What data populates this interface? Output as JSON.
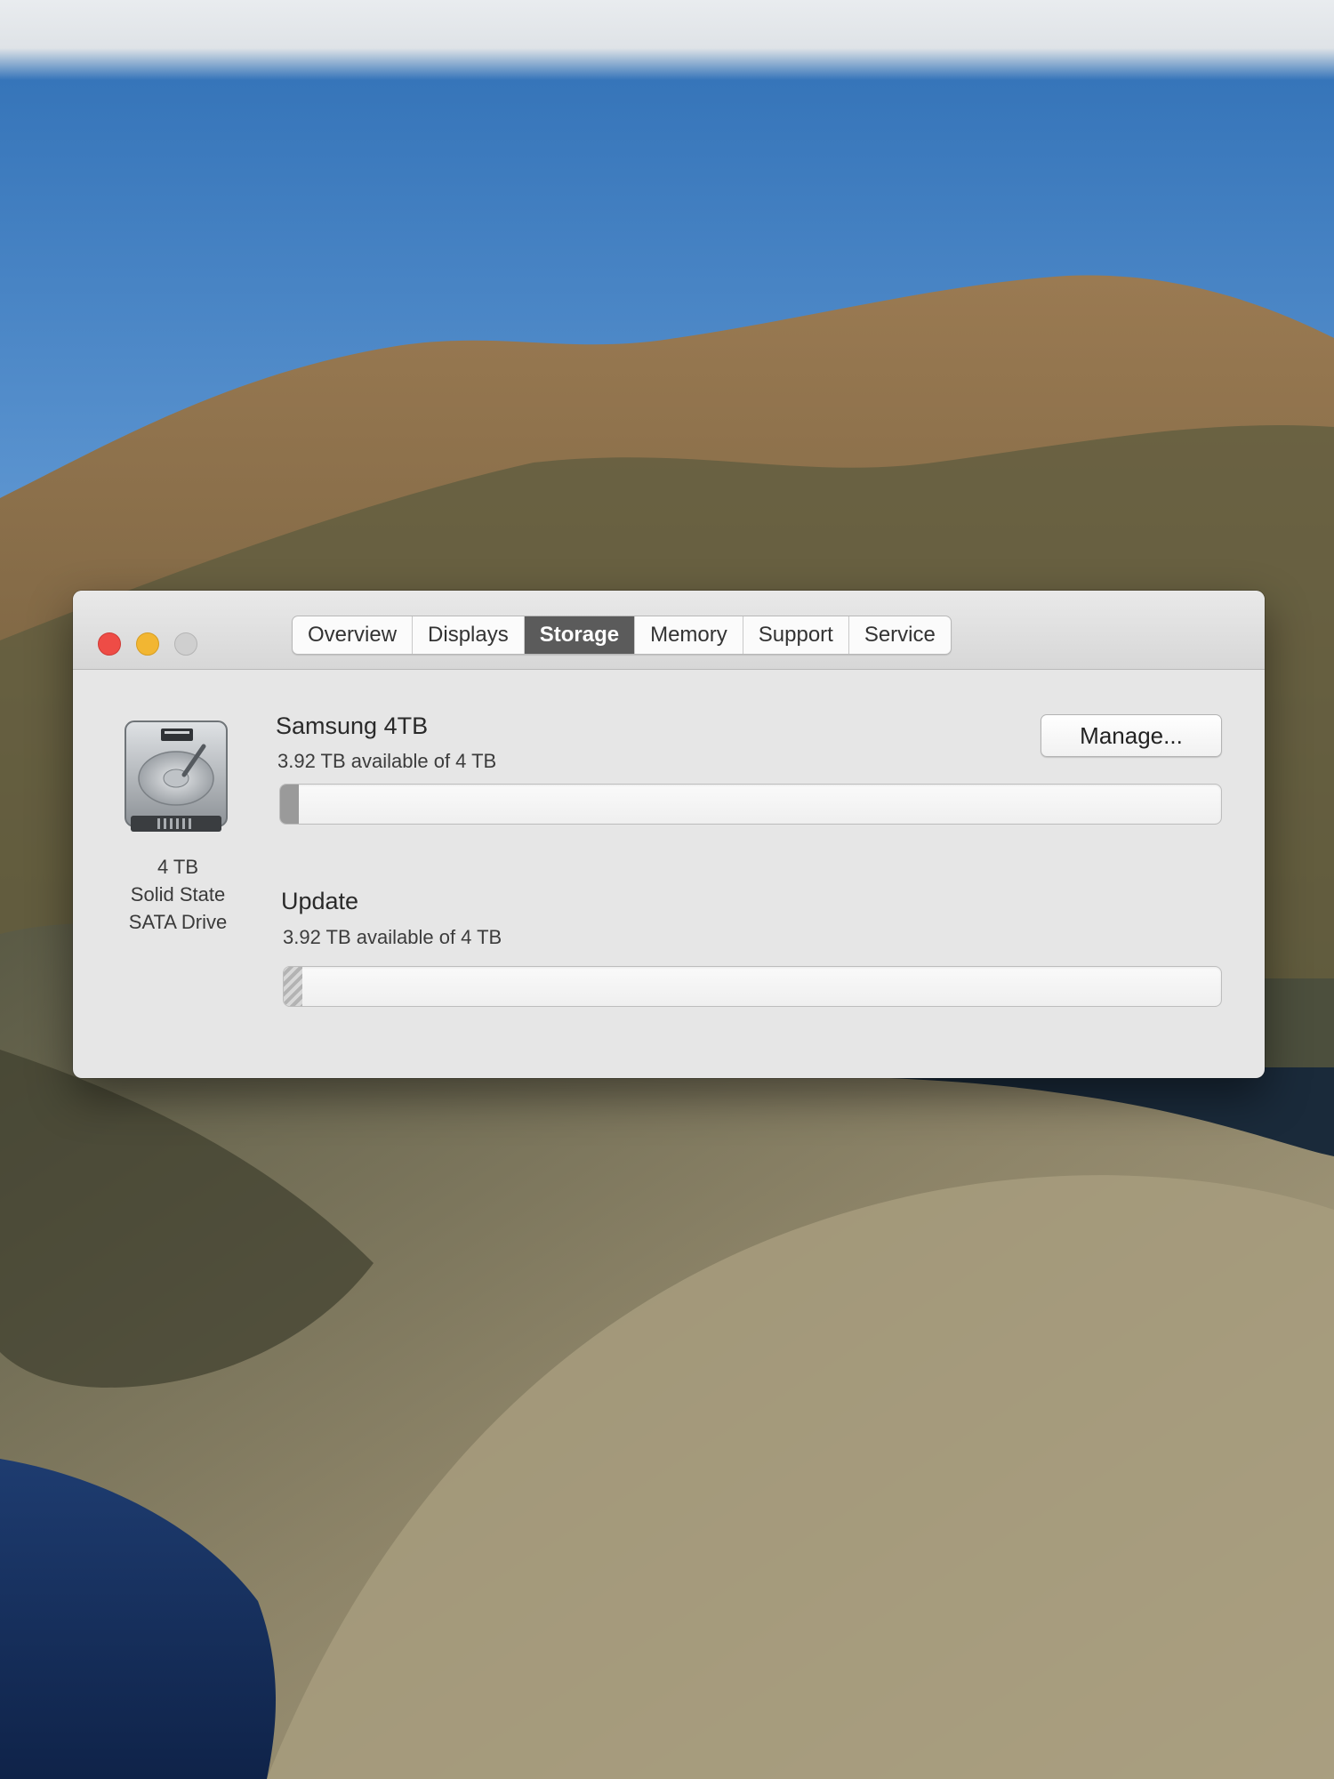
{
  "window": {
    "controls": {
      "close": "close-button",
      "minimize": "minimize-button",
      "zoom": "zoom-button"
    },
    "tabs": [
      {
        "label": "Overview",
        "active": false
      },
      {
        "label": "Displays",
        "active": false
      },
      {
        "label": "Storage",
        "active": true
      },
      {
        "label": "Memory",
        "active": false
      },
      {
        "label": "Support",
        "active": false
      },
      {
        "label": "Service",
        "active": false
      }
    ]
  },
  "storage": {
    "drive": {
      "icon": "hard-drive-icon",
      "capacity": "4 TB",
      "type_line1": "Solid State",
      "type_line2": "SATA Drive"
    },
    "manage_label": "Manage...",
    "volumes": [
      {
        "name": "Samsung 4TB",
        "available": "3.92 TB available of 4 TB",
        "used_fraction": 0.02
      },
      {
        "name": "Update",
        "available": "3.92 TB available of 4 TB",
        "used_fraction": 0.02
      }
    ]
  },
  "colors": {
    "close": "#ee4c46",
    "minimize": "#f2b632",
    "zoom_disabled": "#cfcfcf",
    "active_tab": "#5b5b5b"
  }
}
